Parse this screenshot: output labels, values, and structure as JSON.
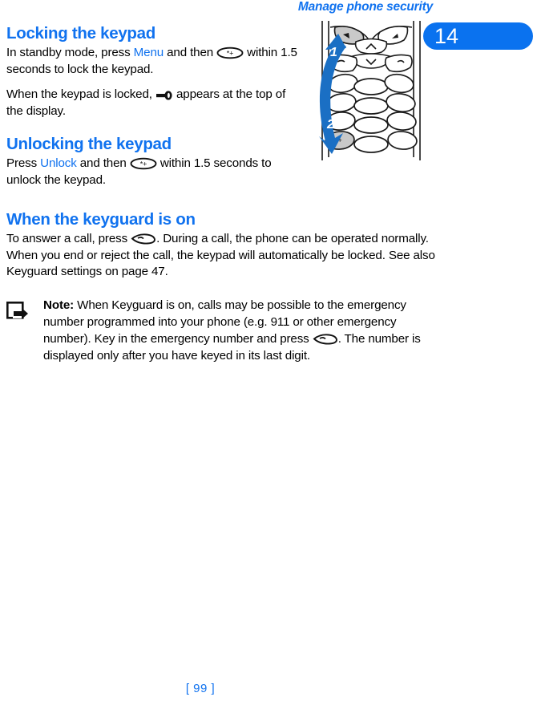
{
  "header": {
    "running_title": "Manage phone security",
    "chapter_number": "14"
  },
  "colors": {
    "accent_blue": "#1072ef",
    "badge_blue": "#0a72ef",
    "arrow_blue": "#1a6fc4",
    "text_black": "#000000",
    "key_highlight_gray": "#c9c9c9"
  },
  "sections": [
    {
      "heading": "Locking the keypad",
      "paragraphs": [
        {
          "parts": [
            {
              "text": "In standby mode, press ",
              "style": "normal"
            },
            {
              "text": "Menu",
              "style": "keyword"
            },
            {
              "text": " and then ",
              "style": "normal"
            },
            {
              "text": "",
              "style": "icon",
              "icon": "star-key-icon"
            },
            {
              "text": " within 1.5 seconds to lock the keypad.",
              "style": "normal"
            }
          ]
        },
        {
          "parts": [
            {
              "text": "When the keypad is locked, ",
              "style": "normal"
            },
            {
              "text": "",
              "style": "icon",
              "icon": "keyguard-key-icon"
            },
            {
              "text": "  appears at the top of the display.",
              "style": "normal"
            }
          ]
        }
      ]
    },
    {
      "heading": "Unlocking the keypad",
      "paragraphs": [
        {
          "parts": [
            {
              "text": "Press ",
              "style": "normal"
            },
            {
              "text": "Unlock",
              "style": "keyword"
            },
            {
              "text": " and then ",
              "style": "normal"
            },
            {
              "text": "",
              "style": "icon",
              "icon": "star-key-icon"
            },
            {
              "text": " within 1.5 seconds to unlock the keypad.",
              "style": "normal"
            }
          ]
        }
      ]
    },
    {
      "heading": "When the keyguard is on",
      "paragraphs": [
        {
          "parts": [
            {
              "text": "To answer a call, press ",
              "style": "normal"
            },
            {
              "text": "",
              "style": "icon",
              "icon": "call-key-icon"
            },
            {
              "text": ". During a call, the phone can be operated normally. When you end or reject the call, the keypad will automatically be locked. See also Keyguard settings on page 47.",
              "style": "normal"
            }
          ]
        }
      ]
    }
  ],
  "text": {
    "heading_locking": "Locking the keypad",
    "heading_unlocking": "Unlocking the keypad",
    "heading_keyguard_on": "When the keyguard is on",
    "p_locking_1a": "In standby mode, press ",
    "p_locking_1_kw": "Menu",
    "p_locking_1b": " and then ",
    "p_locking_1c": " within 1.5 seconds to lock the keypad.",
    "p_locking_2a": "When the keypad is locked, ",
    "p_locking_2b": "  appears at the top of the display.",
    "p_unlocking_a": "Press ",
    "p_unlocking_kw": "Unlock",
    "p_unlocking_b": " and then ",
    "p_unlocking_c": " within 1.5 seconds to unlock the keypad.",
    "p_keyguard_a": "To answer a call, press ",
    "p_keyguard_b": ". During a call, the phone can be operated normally. When you end or reject the call, the keypad will automatically be locked. See also Keyguard settings on page 47."
  },
  "note": {
    "label": "Note:",
    "body_a": " When Keyguard is on, calls may be possible to the emergency number programmed into your phone (e.g. 911 or other emergency number). Key in the emergency number and press ",
    "body_b": ". The number is displayed only after you have keyed in its last digit.",
    "icon": "note-arrow-icon"
  },
  "illustration": {
    "name": "phone-keypad-illustration",
    "arrow_label_1": "1",
    "arrow_label_2": "2",
    "highlighted_keys": [
      "left-soft-key",
      "star-key"
    ],
    "keypad_rows": 4,
    "keypad_columns": 3
  },
  "footer": {
    "page_label": "[ 99 ]"
  }
}
